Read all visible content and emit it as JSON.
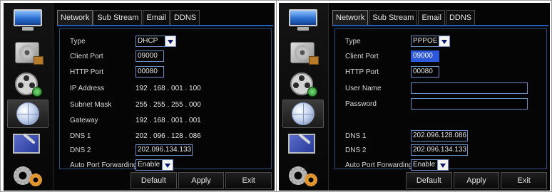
{
  "left": {
    "tabs": [
      "Network",
      "Sub Stream",
      "Email",
      "DDNS"
    ],
    "fields": {
      "type": {
        "label": "Type",
        "value": "DHCP"
      },
      "client_port": {
        "label": "Client Port",
        "value": "09000"
      },
      "http_port": {
        "label": "HTTP Port",
        "value": "00080"
      },
      "ip_address": {
        "label": "IP Address",
        "value": "192 . 168 . 001 . 100"
      },
      "subnet_mask": {
        "label": "Subnet Mask",
        "value": "255 . 255 . 255 . 000"
      },
      "gateway": {
        "label": "Gateway",
        "value": "192 . 168 . 001 . 001"
      },
      "dns1": {
        "label": "DNS 1",
        "value": "202 . 096 . 128 . 086"
      },
      "dns2": {
        "label": "DNS 2",
        "value": "202.096.134.133"
      },
      "auto_port": {
        "label": "Auto Port Forwarding",
        "value": "Enable"
      }
    },
    "buttons": {
      "default": "Default",
      "apply": "Apply",
      "exit": "Exit"
    }
  },
  "right": {
    "tabs": [
      "Network",
      "Sub Stream",
      "Email",
      "DDNS"
    ],
    "fields": {
      "type": {
        "label": "Type",
        "value": "PPPOE"
      },
      "client_port": {
        "label": "Client Port",
        "value": "09000"
      },
      "http_port": {
        "label": "HTTP Port",
        "value": "00080"
      },
      "user_name": {
        "label": "User Name",
        "value": ""
      },
      "password": {
        "label": "Password",
        "value": ""
      },
      "dns1": {
        "label": "DNS 1",
        "value": "202.096.128.086"
      },
      "dns2": {
        "label": "DNS 2",
        "value": "202.096.134.133"
      },
      "auto_port": {
        "label": "Auto Port Forwarding",
        "value": "Enable"
      }
    },
    "buttons": {
      "default": "Default",
      "apply": "Apply",
      "exit": "Exit"
    }
  },
  "sidebar_icons": [
    "monitor-icon",
    "disk-icon",
    "film-reel-icon",
    "network-globe-icon",
    "tools-icon",
    "gear-icon"
  ],
  "colors": {
    "accent": "#1f5fb5",
    "field_border": "#6f8fc4",
    "selection": "#2c59d9",
    "background": "#050505"
  }
}
